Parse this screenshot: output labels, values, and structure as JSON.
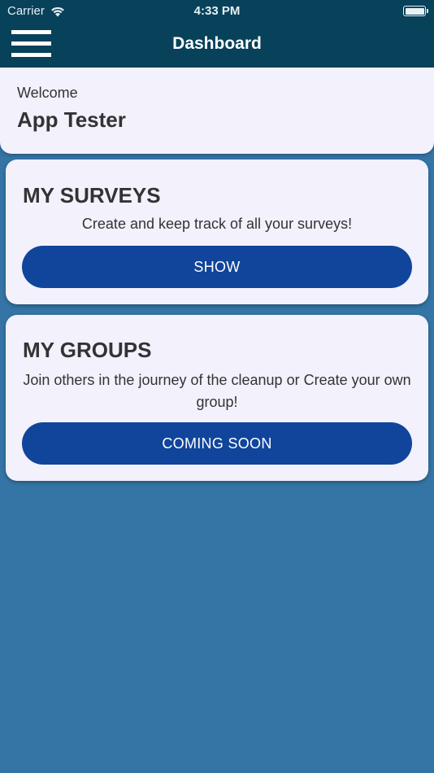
{
  "status_bar": {
    "carrier": "Carrier",
    "time": "4:33 PM"
  },
  "header": {
    "title": "Dashboard",
    "menu_icon": "hamburger-menu-icon"
  },
  "welcome": {
    "label": "Welcome",
    "name": "App Tester"
  },
  "surveys": {
    "title": "MY SURVEYS",
    "description": "Create and keep track of all your surveys!",
    "button_label": "SHOW"
  },
  "groups": {
    "title": "MY GROUPS",
    "description": "Join others in the journey of the cleanup or Create your own group!",
    "button_label": "COMING SOON"
  },
  "colors": {
    "header_bg": "#07415a",
    "page_bg": "#3475a6",
    "card_bg": "#f2f1fc",
    "button_bg": "#10459b"
  }
}
